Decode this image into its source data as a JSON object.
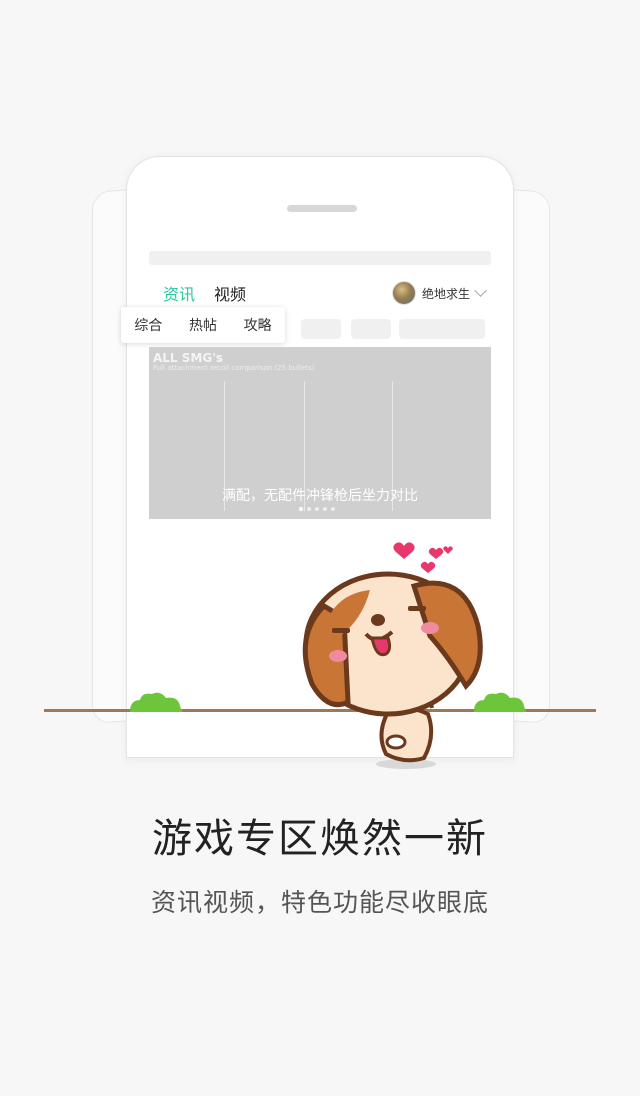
{
  "phone": {
    "tabs": [
      "资讯",
      "视频"
    ],
    "game_selector": {
      "name": "绝地求生",
      "icon": "game-avatar-icon"
    },
    "subtabs": [
      "综合",
      "热帖",
      "攻略"
    ],
    "banner": {
      "title": "ALL SMG's",
      "subtitle": "Full attachment recoil comparison (25 bullets)",
      "caption": "满配，无配件冲锋枪后坐力对比"
    }
  },
  "headline": "游戏专区焕然一新",
  "subline": "资讯视频，特色功能尽收眼底",
  "colors": {
    "accent": "#2bc7a1",
    "ground": "#9b7a5b",
    "bush": "#6cc53a",
    "heart": "#e8386b"
  }
}
